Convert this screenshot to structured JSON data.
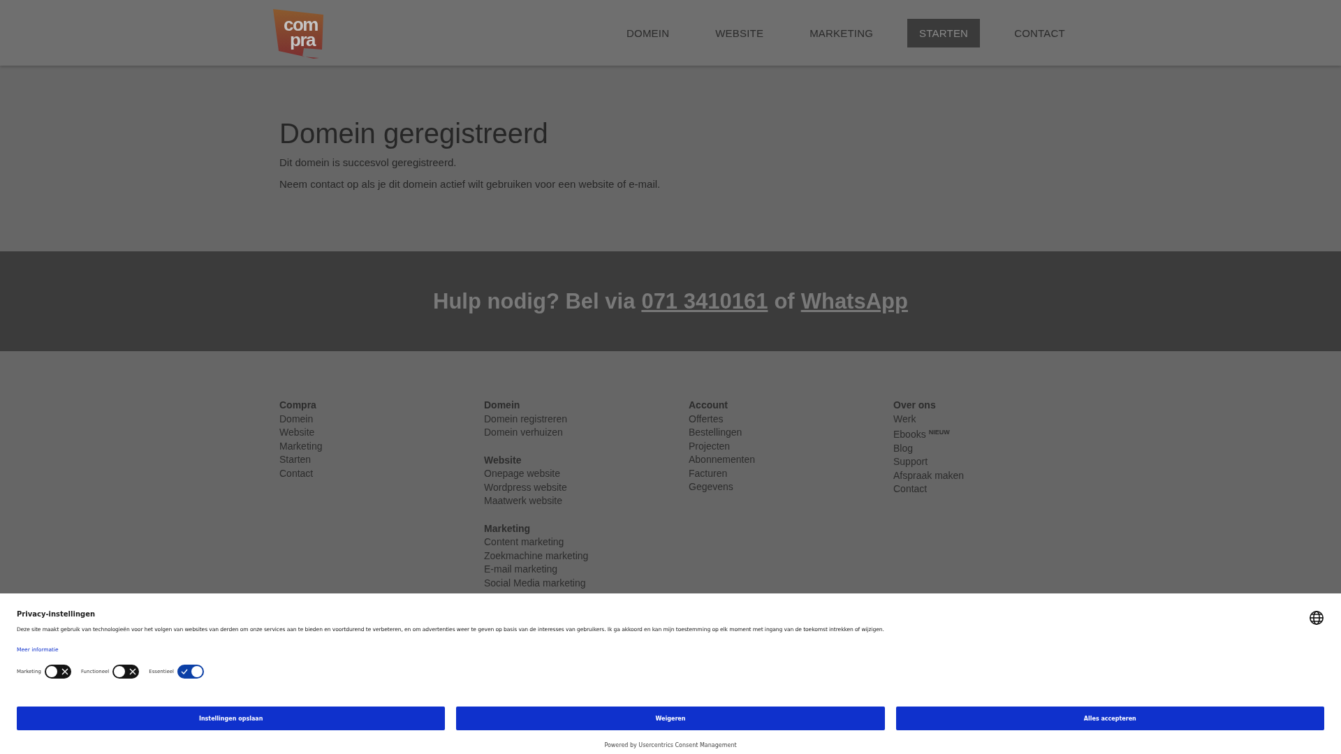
{
  "header": {
    "logo": {
      "line1": "com",
      "line2": "pra"
    },
    "nav": [
      {
        "label": "DOMEIN",
        "selected": false
      },
      {
        "label": "WEBSITE",
        "selected": false
      },
      {
        "label": "MARKETING",
        "selected": false
      },
      {
        "label": "STARTEN",
        "selected": true
      },
      {
        "label": "CONTACT",
        "selected": false
      }
    ]
  },
  "main": {
    "title": "Domein geregistreerd",
    "paragraphs": [
      "Dit domein is succesvol geregistreerd.",
      "Neem contact op als je dit domein actief wilt gebruiken voor een website of e-mail."
    ]
  },
  "help_band": {
    "text": "Hulp nodig? Bel via",
    "phone": "071 3410161",
    "joiner": "of",
    "whatsapp": "WhatsApp"
  },
  "footer": {
    "columns": [
      {
        "groups": [
          {
            "heading": "Compra",
            "links": [
              {
                "label": "Domein"
              },
              {
                "label": "Website"
              },
              {
                "label": "Marketing"
              },
              {
                "label": "Starten"
              },
              {
                "label": "Contact"
              }
            ]
          }
        ]
      },
      {
        "groups": [
          {
            "heading": "Domein",
            "links": [
              {
                "label": "Domein registreren"
              },
              {
                "label": "Domein verhuizen"
              }
            ]
          },
          {
            "heading": "Website",
            "links": [
              {
                "label": "Onepage website"
              },
              {
                "label": "Wordpress website"
              },
              {
                "label": "Maatwerk website"
              }
            ]
          },
          {
            "heading": "Marketing",
            "links": [
              {
                "label": "Content marketing"
              },
              {
                "label": "Zoekmachine marketing"
              },
              {
                "label": "E-mail marketing"
              },
              {
                "label": "Social Media marketing"
              }
            ]
          }
        ]
      },
      {
        "groups": [
          {
            "heading": "Account",
            "links": [
              {
                "label": "Offertes"
              },
              {
                "label": "Bestellingen"
              },
              {
                "label": "Projecten"
              },
              {
                "label": "Abonnementen"
              },
              {
                "label": "Facturen"
              },
              {
                "label": "Gegevens"
              }
            ]
          }
        ]
      },
      {
        "groups": [
          {
            "heading": "Over ons",
            "links": [
              {
                "label": "Werk"
              },
              {
                "label": "Ebooks",
                "badge": "NIEUW"
              },
              {
                "label": "Blog"
              },
              {
                "label": "Support"
              },
              {
                "label": "Afspraak maken"
              },
              {
                "label": "Contact"
              }
            ]
          }
        ]
      }
    ]
  },
  "consent": {
    "title": "Privacy-instellingen",
    "text": "Deze site maakt gebruik van technologieën voor het volgen van websites van derden om onze services aan te bieden en voortdurend te verbeteren, en om advertenties weer te geven op basis van de interesses van gebruikers. Ik ga akkoord en kan mijn toestemming op elk moment met ingang van de toekomst intrekken of wijzigen.",
    "more_link": "Meer informatie",
    "toggles": [
      {
        "label": "Marketing",
        "on": false
      },
      {
        "label": "Functioneel",
        "on": false
      },
      {
        "label": "Essentieel",
        "on": true
      }
    ],
    "buttons": [
      "Instellingen opslaan",
      "Weigeren",
      "Alles accepteren"
    ],
    "powered_by": "Powered by Usercentrics Consent Management"
  }
}
